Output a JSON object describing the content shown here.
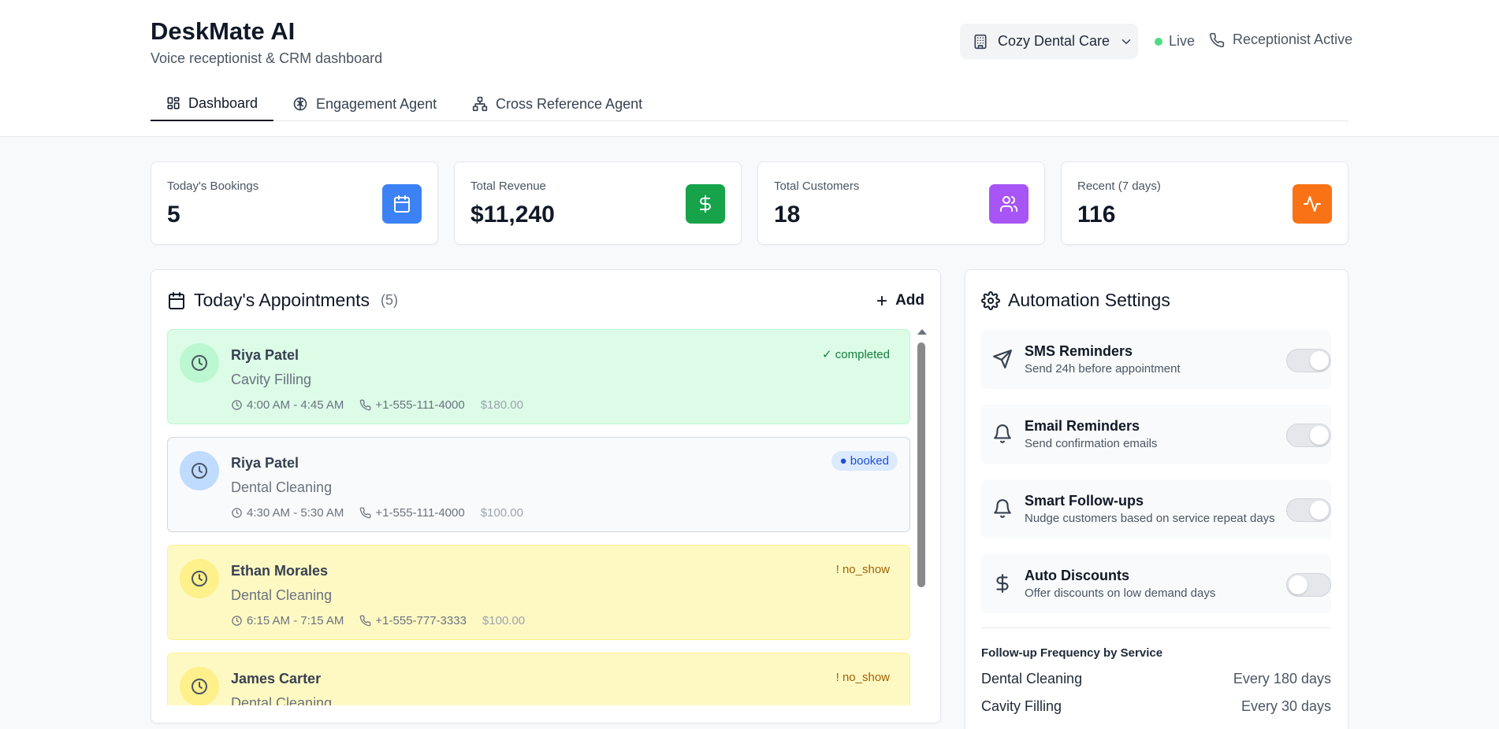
{
  "header": {
    "title": "DeskMate AI",
    "subtitle": "Voice receptionist & CRM dashboard",
    "clinic": "Cozy Dental Care",
    "live_label": "Live",
    "receptionist_label": "Receptionist Active"
  },
  "tabs": [
    {
      "label": "Dashboard",
      "icon": "dashboard-icon",
      "active": true
    },
    {
      "label": "Engagement Agent",
      "icon": "brain-icon",
      "active": false
    },
    {
      "label": "Cross Reference Agent",
      "icon": "network-icon",
      "active": false
    }
  ],
  "stats": [
    {
      "label": "Today's Bookings",
      "value": "5",
      "icon": "calendar-icon",
      "color": "#3b82f6"
    },
    {
      "label": "Total Revenue",
      "value": "$11,240",
      "icon": "dollar-icon",
      "color": "#16a34a"
    },
    {
      "label": "Total Customers",
      "value": "18",
      "icon": "users-icon",
      "color": "#a855f7"
    },
    {
      "label": "Recent (7 days)",
      "value": "116",
      "icon": "activity-icon",
      "color": "#f97316"
    }
  ],
  "appointments": {
    "title": "Today's Appointments",
    "count": "(5)",
    "add_label": "Add",
    "items": [
      {
        "name": "Riya Patel",
        "service": "Cavity Filling",
        "time": "4:00 AM - 4:45 AM",
        "phone": "+1-555-111-4000",
        "price": "$180.00",
        "status": "✓ completed"
      },
      {
        "name": "Riya Patel",
        "service": "Dental Cleaning",
        "time": "4:30 AM - 5:30 AM",
        "phone": "+1-555-111-4000",
        "price": "$100.00",
        "status": "● booked"
      },
      {
        "name": "Ethan Morales",
        "service": "Dental Cleaning",
        "time": "6:15 AM - 7:15 AM",
        "phone": "+1-555-777-3333",
        "price": "$100.00",
        "status": "! no_show"
      },
      {
        "name": "James Carter",
        "service": "Dental Cleaning",
        "time": "",
        "phone": "",
        "price": "",
        "status": "! no_show"
      }
    ]
  },
  "automation": {
    "title": "Automation Settings",
    "settings": [
      {
        "label": "SMS Reminders",
        "desc": "Send 24h before appointment",
        "icon": "send-icon",
        "enabled": true
      },
      {
        "label": "Email Reminders",
        "desc": "Send confirmation emails",
        "icon": "bell-icon",
        "enabled": true
      },
      {
        "label": "Smart Follow-ups",
        "desc": "Nudge customers based on service repeat days",
        "icon": "bell-icon",
        "enabled": true
      },
      {
        "label": "Auto Discounts",
        "desc": "Offer discounts on low demand days",
        "icon": "dollar-icon",
        "enabled": false
      }
    ],
    "frequency_title": "Follow-up Frequency by Service",
    "frequency": [
      {
        "service": "Dental Cleaning",
        "value": "Every 180 days"
      },
      {
        "service": "Cavity Filling",
        "value": "Every 30 days"
      }
    ]
  }
}
